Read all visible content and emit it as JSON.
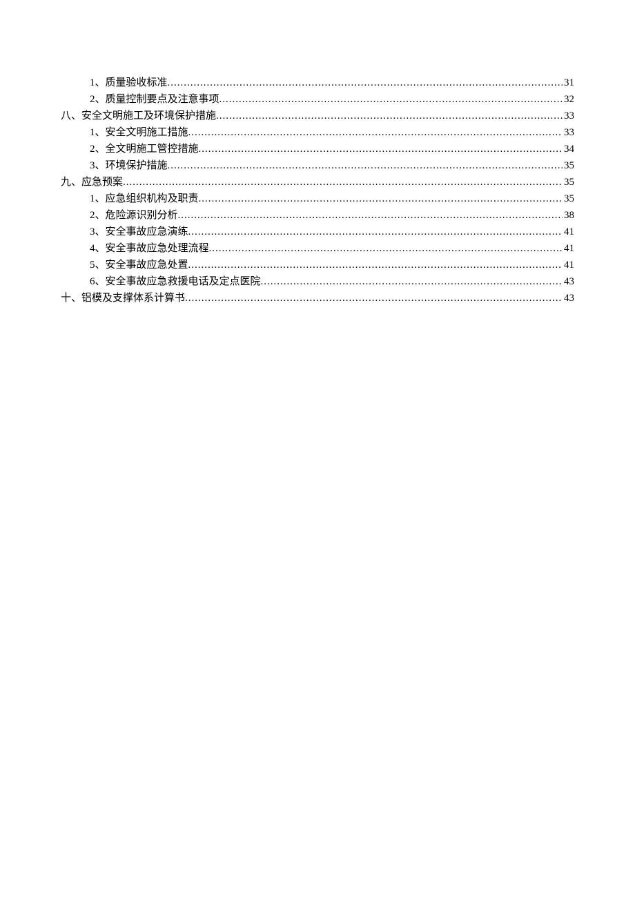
{
  "toc": [
    {
      "level": 2,
      "label": "1、质量验收标准",
      "page": "31"
    },
    {
      "level": 2,
      "label": "2、质量控制要点及注意事项",
      "page": "32"
    },
    {
      "level": 1,
      "label": "八、安全文明施工及环境保护措施",
      "page": "33"
    },
    {
      "level": 2,
      "label": "1、安全文明施工措施",
      "page": "33"
    },
    {
      "level": 2,
      "label": "2、全文明施工管控措施",
      "page": "34"
    },
    {
      "level": 2,
      "label": "3、环境保护措施",
      "page": "35"
    },
    {
      "level": 1,
      "label": "九、应急预案",
      "page": "35"
    },
    {
      "level": 2,
      "label": "1、应急组织机构及职责",
      "page": "35"
    },
    {
      "level": 2,
      "label": "2、危险源识别分析",
      "page": "38"
    },
    {
      "level": 2,
      "label": "3、安全事故应急演练",
      "page": "41"
    },
    {
      "level": 2,
      "label": "4、安全事故应急处理流程",
      "page": "41"
    },
    {
      "level": 2,
      "label": "5、安全事故应急处置",
      "page": "41"
    },
    {
      "level": 2,
      "label": "6、安全事故应急救援电话及定点医院",
      "page": "43"
    },
    {
      "level": 1,
      "label": "十、铝模及支撑体系计算书",
      "page": "43"
    }
  ]
}
